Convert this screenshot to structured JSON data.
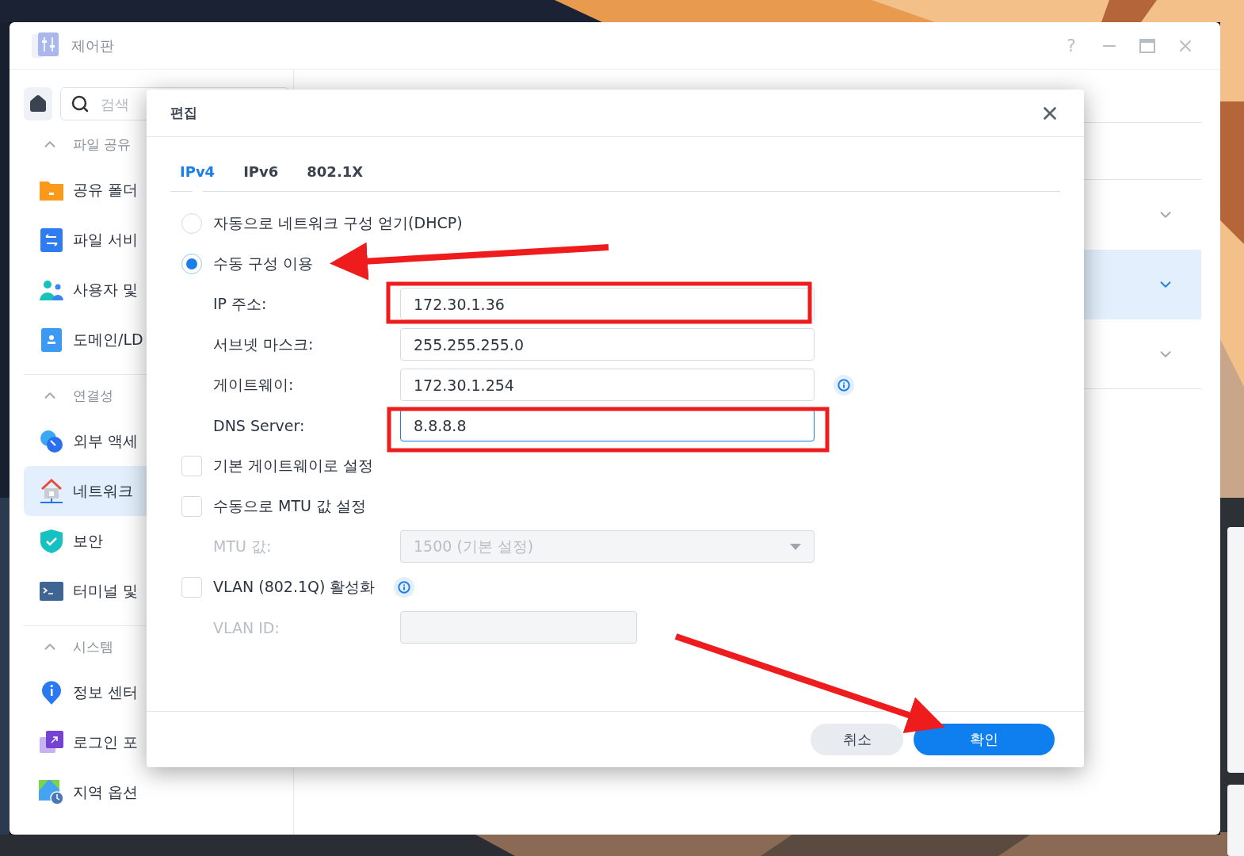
{
  "window": {
    "title": "제어판",
    "help": "?"
  },
  "sidebar": {
    "search": {
      "placeholder": "검색"
    },
    "sections": [
      {
        "title": "파일 공유",
        "expanded": true,
        "items": [
          {
            "label": "공유 폴더",
            "selected": false
          },
          {
            "label": "파일 서비",
            "selected": false
          },
          {
            "label": "사용자 및",
            "selected": false
          },
          {
            "label": "도메인/LD",
            "selected": false
          }
        ]
      },
      {
        "title": "연결성",
        "expanded": true,
        "items": [
          {
            "label": "외부 액세",
            "selected": false
          },
          {
            "label": "네트워크",
            "selected": true
          },
          {
            "label": "보안",
            "selected": false
          },
          {
            "label": "터미널 및",
            "selected": false
          }
        ]
      },
      {
        "title": "시스템",
        "expanded": true,
        "items": [
          {
            "label": "정보 센터",
            "selected": false
          },
          {
            "label": "로그인 포",
            "selected": false
          },
          {
            "label": "지역 옵션",
            "selected": false
          }
        ]
      }
    ]
  },
  "content": {
    "rows": [
      {
        "selected": false
      },
      {
        "selected": true
      },
      {
        "selected": false
      }
    ]
  },
  "dialog": {
    "title": "편집",
    "tabs": [
      {
        "label": "IPv4",
        "selected": true
      },
      {
        "label": "IPv6",
        "selected": false
      },
      {
        "label": "802.1X",
        "selected": false
      }
    ],
    "items": [
      {
        "kind": "radio",
        "label": "자동으로 네트워크 구성 얻기(DHCP)",
        "selected": false
      },
      {
        "kind": "radio",
        "label": "수동 구성 이용",
        "selected": true
      },
      {
        "kind": "field",
        "label": "IP 주소:",
        "value": "172.30.1.36",
        "focused": false,
        "disabled": false
      },
      {
        "kind": "field",
        "label": "서브넷 마스크:",
        "value": "255.255.255.0",
        "focused": false,
        "disabled": false
      },
      {
        "kind": "field",
        "label": "게이트웨이:",
        "value": "172.30.1.254",
        "focused": false,
        "disabled": false,
        "info": true
      },
      {
        "kind": "field",
        "label": "DNS Server:",
        "value": "8.8.8.8",
        "focused": true,
        "disabled": false
      },
      {
        "kind": "checkbox",
        "label": "기본 게이트웨이로 설정",
        "checked": false
      },
      {
        "kind": "checkbox",
        "label": "수동으로 MTU 값 설정",
        "checked": false
      },
      {
        "kind": "select",
        "label": "MTU 값:",
        "value": "1500 (기본 설정)",
        "disabled": true
      },
      {
        "kind": "checkbox",
        "label": "VLAN (802.1Q) 활성화",
        "checked": false,
        "info": true
      },
      {
        "kind": "short-field",
        "label": "VLAN ID:",
        "disabled": true
      }
    ],
    "buttons": [
      {
        "label": "취소",
        "primary": false
      },
      {
        "label": "확인",
        "primary": true
      }
    ]
  }
}
